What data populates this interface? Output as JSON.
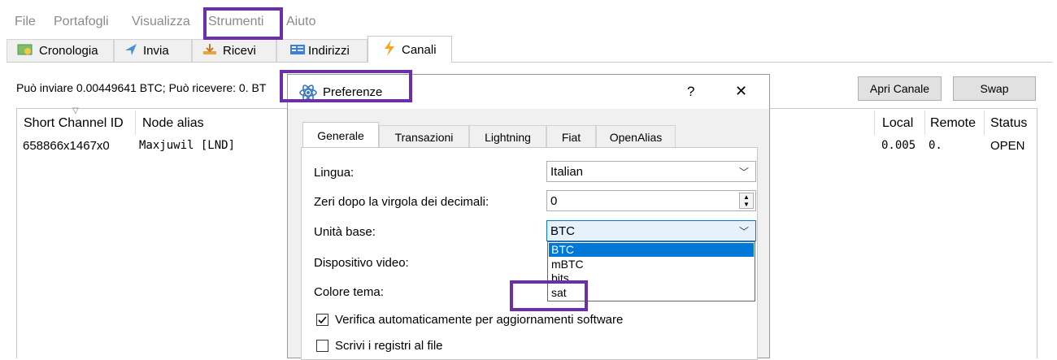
{
  "menu": [
    "File",
    "Portafogli",
    "Visualizza",
    "Strumenti",
    "Aiuto"
  ],
  "tabs": [
    {
      "label": "Cronologia",
      "icon": "history-icon"
    },
    {
      "label": "Invia",
      "icon": "send-icon"
    },
    {
      "label": "Ricevi",
      "icon": "receive-icon"
    },
    {
      "label": "Indirizzi",
      "icon": "addresses-icon"
    },
    {
      "label": "Canali",
      "icon": "lightning-icon"
    }
  ],
  "info_text": "Può inviare 0.00449641 BTC; Può ricevere: 0. BT",
  "buttons": {
    "open_channel": "Apri Canale",
    "swap": "Swap"
  },
  "table": {
    "headers": [
      "Short Channel ID",
      "Node alias",
      "Local",
      "Remote",
      "Status"
    ],
    "rows": [
      [
        "658866x1467x0",
        "Maxjuwil [LND]",
        "0.005",
        "0.",
        "OPEN"
      ]
    ]
  },
  "dialog": {
    "title": "Preferenze",
    "help": "?",
    "close": "✕",
    "tabs": [
      "Generale",
      "Transazioni",
      "Lightning",
      "Fiat",
      "OpenAlias"
    ],
    "fields": {
      "language_label": "Lingua:",
      "language_value": "Italian",
      "decimals_label": "Zeri dopo la virgola dei decimali:",
      "decimals_value": "0",
      "unit_label": "Unità base:",
      "unit_value": "BTC",
      "unit_options": [
        "BTC",
        "mBTC",
        "bits",
        "sat"
      ],
      "video_label": "Dispositivo video:",
      "theme_label": "Colore tema:",
      "check_updates_label": "Verifica automaticamente per aggiornamenti software",
      "check_updates_checked": true,
      "write_logs_label": "Scrivi i registri al file",
      "write_logs_checked": false
    }
  },
  "colors": {
    "highlight": "#6b2fa8",
    "selection": "#0078d7"
  }
}
